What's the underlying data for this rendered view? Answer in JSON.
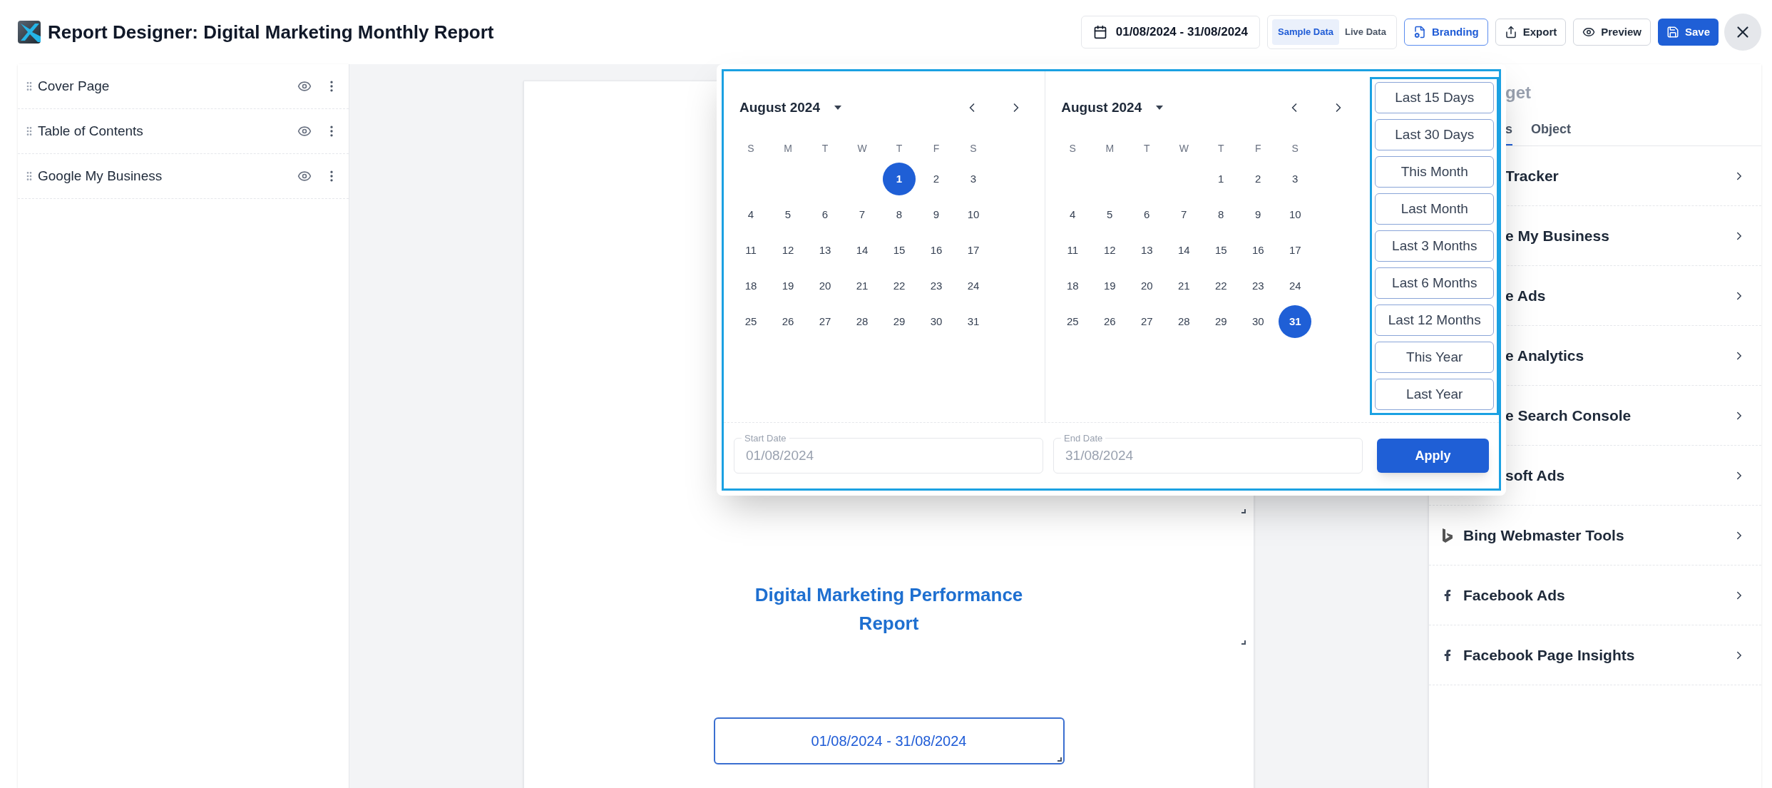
{
  "header": {
    "title": "Report Designer: Digital Marketing Monthly Report",
    "date_range": "01/08/2024 - 31/08/2024",
    "data_modes": [
      {
        "label": "Sample Data",
        "selected": true
      },
      {
        "label": "Live Data",
        "selected": false
      }
    ],
    "buttons": [
      {
        "kind": "branding",
        "label": "Branding"
      },
      {
        "kind": "export",
        "label": "Export"
      },
      {
        "kind": "preview",
        "label": "Preview"
      },
      {
        "kind": "save",
        "label": "Save"
      }
    ]
  },
  "pages": [
    {
      "label": "Cover Page"
    },
    {
      "label": "Table of Contents"
    },
    {
      "label": "Google My Business"
    }
  ],
  "report_page": {
    "subtitle": "Digital Marketing Performance Report",
    "date_range": "01/08/2024 - 31/08/2024"
  },
  "widget_panel": {
    "title": "get",
    "tabs": [
      {
        "label": "s",
        "selected": true
      },
      {
        "label": "Object",
        "selected": false
      }
    ],
    "items": [
      {
        "kind": "covered",
        "label": "Tracker"
      },
      {
        "kind": "covered",
        "label": "e My Business"
      },
      {
        "kind": "covered",
        "label": "e Ads"
      },
      {
        "kind": "covered",
        "label": "e Analytics"
      },
      {
        "kind": "covered",
        "label": "e Search Console"
      },
      {
        "kind": "covered",
        "label": "soft Ads"
      },
      {
        "kind": "bing",
        "label": "Bing Webmaster Tools"
      },
      {
        "kind": "facebook-ads",
        "label": "Facebook Ads"
      },
      {
        "kind": "facebook",
        "label": "Facebook Page Insights"
      }
    ]
  },
  "date_picker": {
    "months": [
      {
        "title": "August 2024",
        "weekdays": [
          "S",
          "M",
          "T",
          "W",
          "T",
          "F",
          "S"
        ],
        "weeks": [
          [
            {
              "day": "1",
              "selected": true
            },
            {
              "day": "2",
              "selected": false
            },
            {
              "day": "3",
              "selected": false
            }
          ],
          [
            {
              "day": "4",
              "selected": false
            },
            {
              "day": "5",
              "selected": false
            },
            {
              "day": "6",
              "selected": false
            },
            {
              "day": "7",
              "selected": false
            },
            {
              "day": "8",
              "selected": false
            },
            {
              "day": "9",
              "selected": false
            },
            {
              "day": "10",
              "selected": false
            }
          ],
          [
            {
              "day": "11",
              "selected": false
            },
            {
              "day": "12",
              "selected": false
            },
            {
              "day": "13",
              "selected": false
            },
            {
              "day": "14",
              "selected": false
            },
            {
              "day": "15",
              "selected": false
            },
            {
              "day": "16",
              "selected": false
            },
            {
              "day": "17",
              "selected": false
            }
          ],
          [
            {
              "day": "18",
              "selected": false
            },
            {
              "day": "19",
              "selected": false
            },
            {
              "day": "20",
              "selected": false
            },
            {
              "day": "21",
              "selected": false
            },
            {
              "day": "22",
              "selected": false
            },
            {
              "day": "23",
              "selected": false
            },
            {
              "day": "24",
              "selected": false
            }
          ],
          [
            {
              "day": "25",
              "selected": false
            },
            {
              "day": "26",
              "selected": false
            },
            {
              "day": "27",
              "selected": false
            },
            {
              "day": "28",
              "selected": false
            },
            {
              "day": "29",
              "selected": false
            },
            {
              "day": "30",
              "selected": false
            },
            {
              "day": "31",
              "selected": false
            }
          ]
        ]
      },
      {
        "title": "August 2024",
        "weekdays": [
          "S",
          "M",
          "T",
          "W",
          "T",
          "F",
          "S"
        ],
        "weeks": [
          [
            {
              "day": "1",
              "selected": false
            },
            {
              "day": "2",
              "selected": false
            },
            {
              "day": "3",
              "selected": false
            }
          ],
          [
            {
              "day": "4",
              "selected": false
            },
            {
              "day": "5",
              "selected": false
            },
            {
              "day": "6",
              "selected": false
            },
            {
              "day": "7",
              "selected": false
            },
            {
              "day": "8",
              "selected": false
            },
            {
              "day": "9",
              "selected": false
            },
            {
              "day": "10",
              "selected": false
            }
          ],
          [
            {
              "day": "11",
              "selected": false
            },
            {
              "day": "12",
              "selected": false
            },
            {
              "day": "13",
              "selected": false
            },
            {
              "day": "14",
              "selected": false
            },
            {
              "day": "15",
              "selected": false
            },
            {
              "day": "16",
              "selected": false
            },
            {
              "day": "17",
              "selected": false
            }
          ],
          [
            {
              "day": "18",
              "selected": false
            },
            {
              "day": "19",
              "selected": false
            },
            {
              "day": "20",
              "selected": false
            },
            {
              "day": "21",
              "selected": false
            },
            {
              "day": "22",
              "selected": false
            },
            {
              "day": "23",
              "selected": false
            },
            {
              "day": "24",
              "selected": false
            }
          ],
          [
            {
              "day": "25",
              "selected": false
            },
            {
              "day": "26",
              "selected": false
            },
            {
              "day": "27",
              "selected": false
            },
            {
              "day": "28",
              "selected": false
            },
            {
              "day": "29",
              "selected": false
            },
            {
              "day": "30",
              "selected": false
            },
            {
              "day": "31",
              "selected": true
            }
          ]
        ]
      }
    ],
    "presets": [
      "Last 15 Days",
      "Last 30 Days",
      "This Month",
      "Last Month",
      "Last 3 Months",
      "Last 6 Months",
      "Last 12 Months",
      "This Year",
      "Last Year"
    ],
    "start_date": {
      "label": "Start Date",
      "value": "01/08/2024"
    },
    "end_date": {
      "label": "End Date",
      "value": "31/08/2024"
    },
    "apply": "Apply"
  }
}
